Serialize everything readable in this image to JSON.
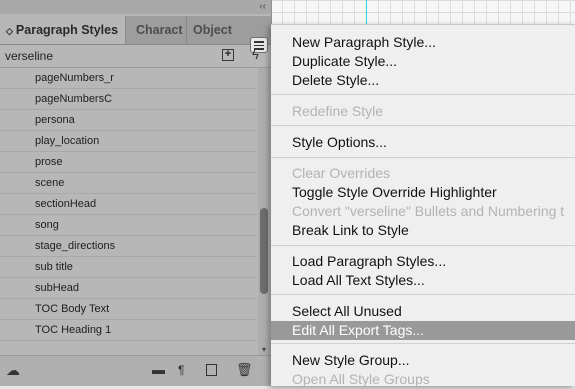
{
  "panel": {
    "tabs": [
      {
        "label": "Paragraph Styles",
        "arrows": "◇"
      },
      {
        "label": "Charact"
      },
      {
        "label": "Object S"
      }
    ],
    "current_style": "verseline",
    "styles": [
      "pageNumbers_r",
      "pageNumbersC",
      "persona",
      "play_location",
      "prose",
      "scene",
      "sectionHead",
      "song",
      "stage_directions",
      "sub title",
      "subHead",
      "TOC Body Text",
      "TOC Heading 1"
    ]
  },
  "menu": {
    "items": {
      "new_paragraph_style": "New Paragraph Style...",
      "duplicate_style": "Duplicate Style...",
      "delete_style": "Delete Style...",
      "redefine_style": "Redefine Style",
      "style_options": "Style Options...",
      "clear_overrides": "Clear Overrides",
      "toggle_override_highlighter": "Toggle Style Override Highlighter",
      "convert_bullets": "Convert \"verseline\" Bullets and Numbering t",
      "break_link": "Break Link to Style",
      "load_paragraph_styles": "Load Paragraph Styles...",
      "load_all_text_styles": "Load All Text Styles...",
      "select_all_unused": "Select All Unused",
      "edit_all_export_tags": "Edit All Export Tags...",
      "new_style_group": "New Style Group...",
      "open_all_style_groups": "Open All Style Groups"
    },
    "highlighted": "Edit All Export Tags..."
  },
  "colors": {
    "panel_bg": "#b7b7b7",
    "menu_bg": "#efefef",
    "highlight": "#999999",
    "disabled_text": "#b3b3b3"
  }
}
